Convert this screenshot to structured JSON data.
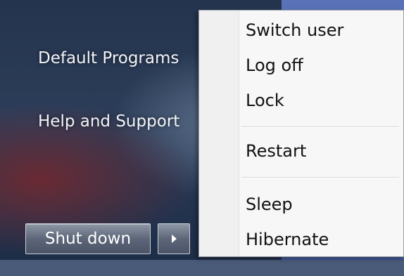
{
  "left_menu": {
    "default_programs": "Default Programs",
    "help_support": "Help and Support"
  },
  "shutdown": {
    "label": "Shut down"
  },
  "power_menu": {
    "items": [
      "Switch user",
      "Log off",
      "Lock",
      "Restart",
      "Sleep",
      "Hibernate"
    ]
  }
}
